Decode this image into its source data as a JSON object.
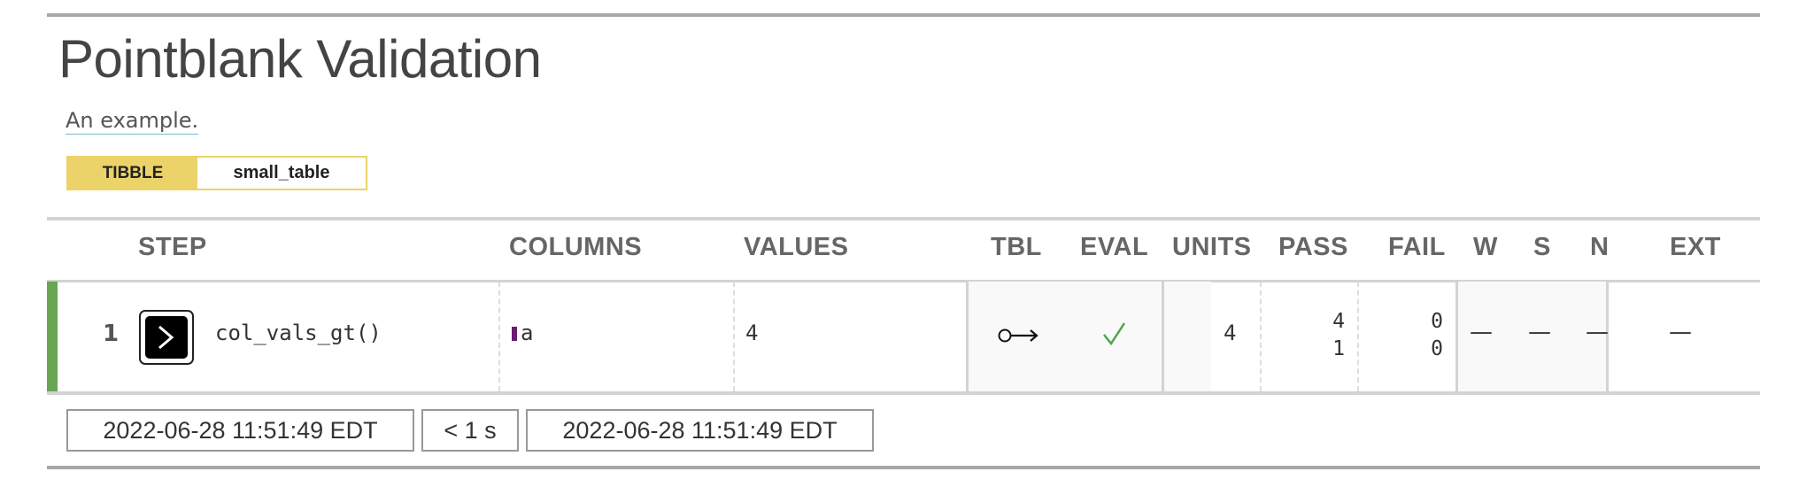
{
  "report": {
    "title": "Pointblank Validation",
    "subtitle": "An example.",
    "table_type": "TIBBLE",
    "table_name": "small_table"
  },
  "columns": {
    "step": "STEP",
    "columns": "COLUMNS",
    "values": "VALUES",
    "tbl": "TBL",
    "eval": "EVAL",
    "units": "UNITS",
    "pass": "PASS",
    "fail": "FAIL",
    "w": "W",
    "s": "S",
    "n": "N",
    "ext": "EXT"
  },
  "rows": [
    {
      "step_number": "1",
      "function": "col_vals_gt()",
      "column": "a",
      "value": "4",
      "tbl_icon": "unchanged-table-icon",
      "eval_icon": "checkmark-icon",
      "units": "4",
      "pass_count": "4",
      "pass_fraction": "1",
      "fail_count": "0",
      "fail_fraction": "0",
      "w": "—",
      "s": "—",
      "n": "—",
      "ext": "—",
      "status_color": "#66A654"
    }
  ],
  "footer": {
    "start_time": "2022-06-28 11:51:49 EDT",
    "duration": "< 1 s",
    "end_time": "2022-06-28 11:51:49 EDT"
  },
  "colors": {
    "badge_accent": "#EBD36A",
    "pass_indicator": "#66A654",
    "column_marker": "#6A1B6B",
    "checkmark": "#4CA64C"
  }
}
